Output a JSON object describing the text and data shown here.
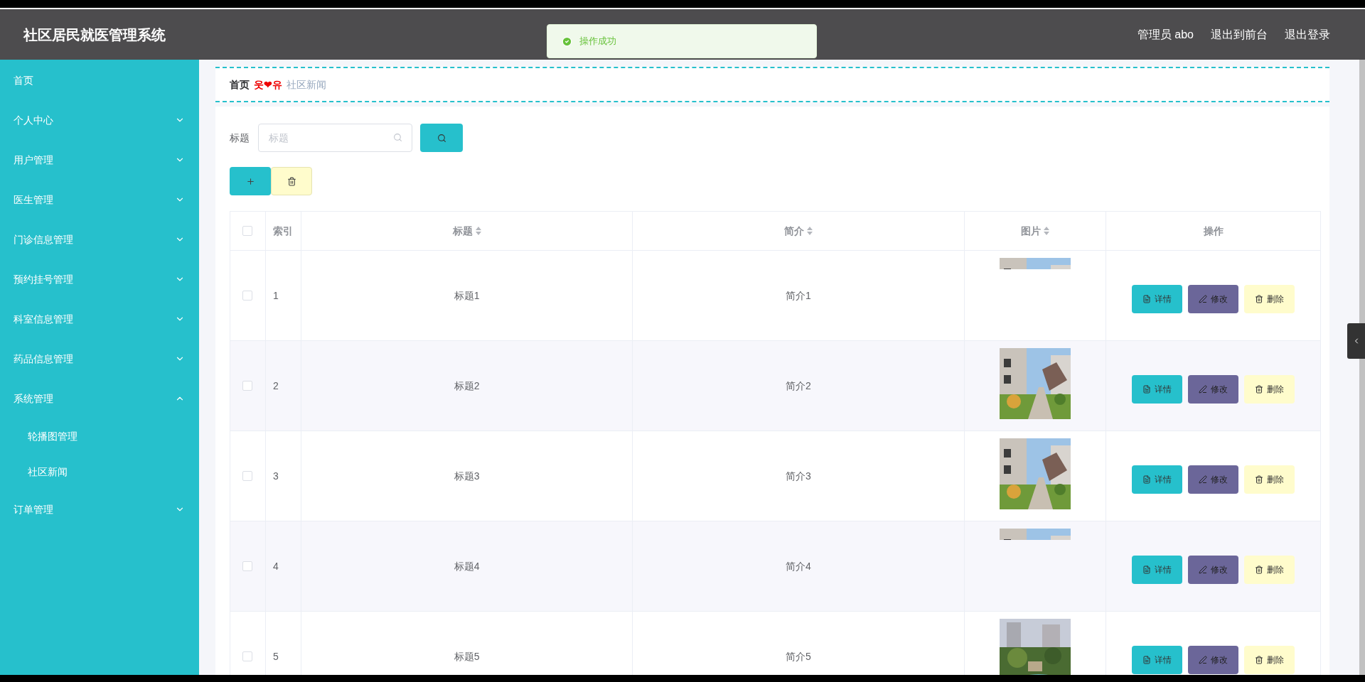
{
  "header": {
    "title": "社区居民就医管理系统",
    "user": "管理员 abo",
    "links": [
      "退出到前台",
      "退出登录"
    ]
  },
  "toast": {
    "message": "操作成功"
  },
  "sidebar": {
    "items": [
      {
        "label": "首页",
        "kind": "link"
      },
      {
        "label": "个人中心",
        "kind": "group",
        "expanded": false
      },
      {
        "label": "用户管理",
        "kind": "group",
        "expanded": false
      },
      {
        "label": "医生管理",
        "kind": "group",
        "expanded": false
      },
      {
        "label": "门诊信息管理",
        "kind": "group",
        "expanded": false
      },
      {
        "label": "预约挂号管理",
        "kind": "group",
        "expanded": false
      },
      {
        "label": "科室信息管理",
        "kind": "group",
        "expanded": false
      },
      {
        "label": "药品信息管理",
        "kind": "group",
        "expanded": false
      },
      {
        "label": "系统管理",
        "kind": "group",
        "expanded": true,
        "children": [
          {
            "label": "轮播图管理"
          },
          {
            "label": "社区新闻"
          }
        ]
      },
      {
        "label": "订单管理",
        "kind": "group",
        "expanded": false
      }
    ]
  },
  "breadcrumb": {
    "items": [
      "首页",
      "社区新闻"
    ],
    "separator": "웃❤유"
  },
  "search": {
    "label": "标题",
    "placeholder": "标题"
  },
  "table": {
    "all_checked": false,
    "columns": [
      {
        "label": "索引",
        "sortable": false
      },
      {
        "label": "标题",
        "sortable": true
      },
      {
        "label": "简介",
        "sortable": true
      },
      {
        "label": "图片",
        "sortable": true
      },
      {
        "label": "操作",
        "sortable": false
      }
    ],
    "rows": [
      {
        "index": "1",
        "title": "标题1",
        "summary": "简介1",
        "checked": false,
        "image_loaded": false,
        "actions": [
          "详情",
          "修改",
          "删除"
        ]
      },
      {
        "index": "2",
        "title": "标题2",
        "summary": "简介2",
        "checked": false,
        "image_loaded": true,
        "actions": [
          "详情",
          "修改",
          "删除"
        ]
      },
      {
        "index": "3",
        "title": "标题3",
        "summary": "简介3",
        "checked": false,
        "image_loaded": true,
        "actions": [
          "详情",
          "修改",
          "删除"
        ]
      },
      {
        "index": "4",
        "title": "标题4",
        "summary": "简介4",
        "checked": false,
        "image_loaded": false,
        "actions": [
          "详情",
          "修改",
          "删除"
        ]
      },
      {
        "index": "5",
        "title": "标题5",
        "summary": "简介5",
        "checked": false,
        "image_loaded": true,
        "actions": [
          "详情",
          "修改",
          "删除"
        ]
      }
    ]
  }
}
